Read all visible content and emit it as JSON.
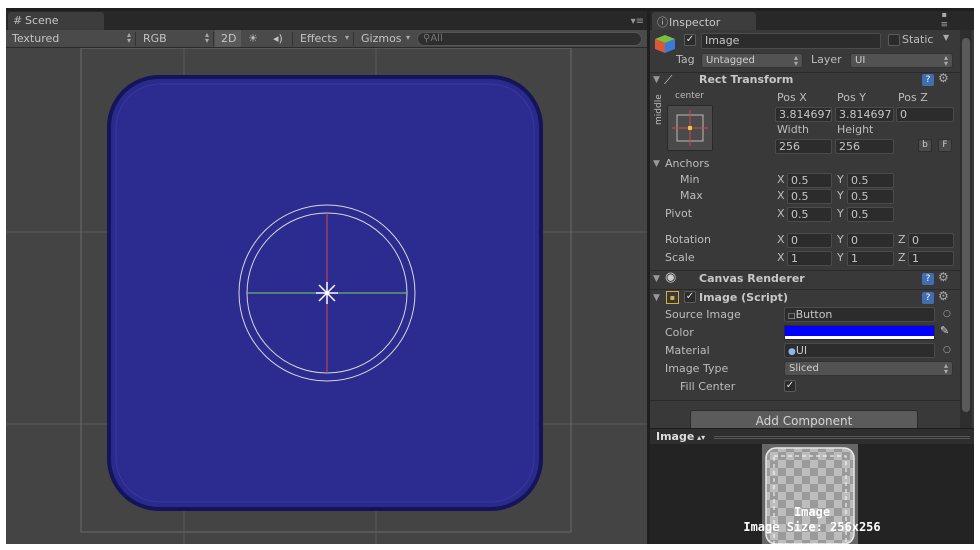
{
  "scene": {
    "tab_label": "Scene",
    "shading_mode": "Textured",
    "render_mode": "RGB",
    "toggle_2d": "2D",
    "effects_label": "Effects",
    "gizmos_label": "Gizmos",
    "search_placeholder": "All"
  },
  "inspector": {
    "tab_label": "Inspector",
    "object_name": "Image",
    "static_label": "Static",
    "tag_label": "Tag",
    "tag_value": "Untagged",
    "layer_label": "Layer",
    "layer_value": "UI",
    "rect_transform": {
      "title": "Rect Transform",
      "anchor_h": "center",
      "anchor_v": "middle",
      "pos_x_label": "Pos X",
      "pos_y_label": "Pos Y",
      "pos_z_label": "Pos Z",
      "pos_x": "3.814697",
      "pos_y": "3.814697",
      "pos_z": "0",
      "width_label": "Width",
      "height_label": "Height",
      "width": "256",
      "height": "256",
      "blueprint_btn": "b",
      "raw_btn": "F",
      "anchors_label": "Anchors",
      "min_label": "Min",
      "max_label": "Max",
      "pivot_label": "Pivot",
      "x_label": "X",
      "y_label": "Y",
      "z_label": "Z",
      "min_x": "0.5",
      "min_y": "0.5",
      "max_x": "0.5",
      "max_y": "0.5",
      "pivot_x": "0.5",
      "pivot_y": "0.5",
      "rotation_label": "Rotation",
      "rot_x": "0",
      "rot_y": "0",
      "rot_z": "0",
      "scale_label": "Scale",
      "scale_x": "1",
      "scale_y": "1",
      "scale_z": "1"
    },
    "canvas_renderer": {
      "title": "Canvas Renderer"
    },
    "image_script": {
      "title": "Image (Script)",
      "source_image_label": "Source Image",
      "source_image_value": "Button",
      "color_label": "Color",
      "color_value": "#0000ff",
      "material_label": "Material",
      "material_value": "UI",
      "image_type_label": "Image Type",
      "image_type_value": "Sliced",
      "fill_center_label": "Fill Center"
    },
    "add_component_label": "Add Component",
    "preview": {
      "dropdown_label": "Image",
      "caption_name": "Image",
      "caption_size": "Image Size: 256x256"
    }
  },
  "colors": {
    "scene_bg": "#444444",
    "button_fill": "#2a2a8c",
    "color_swatch": "#0000ff",
    "help_icon": "#3f6fb0"
  }
}
